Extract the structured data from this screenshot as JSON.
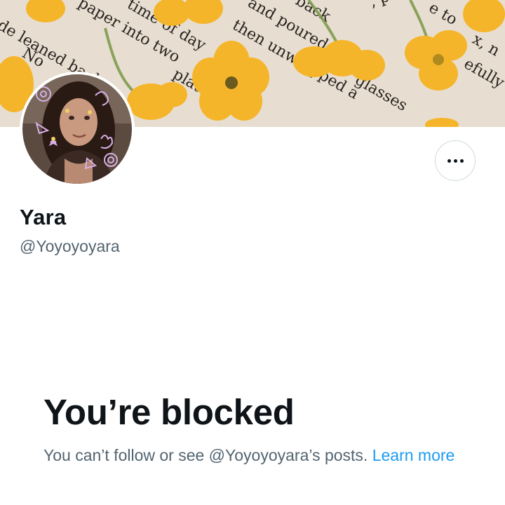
{
  "profile": {
    "display_name": "Yara",
    "handle": "@Yoyoyoyara"
  },
  "banner": {
    "book_text_lines": [
      "de leaned back",
      "paper into two",
      "time of day",
      "then unwrapped a",
      "and poured",
      "back",
      ", place",
      "glasses",
      "e to",
      "x, n",
      "efully",
      "No",
      "plate"
    ]
  },
  "more_button": {
    "icon": "more-horizontal-icon"
  },
  "blocked": {
    "title": "You’re blocked",
    "message": "You can’t follow or see @Yoyoyoyara’s posts.",
    "learn_more": "Learn more"
  },
  "colors": {
    "text_primary": "#0f1419",
    "text_secondary": "#536471",
    "link": "#1d9bf0",
    "flower": "#f5b52a"
  }
}
